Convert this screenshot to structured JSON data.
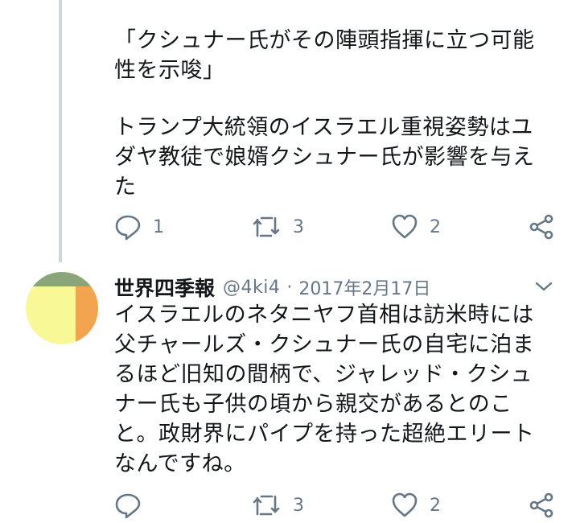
{
  "parent_tweet": {
    "text_1": "「クシュナー氏がその陣頭指揮に立つ可能性を示唆」",
    "text_2": "トランプ大統領のイスラエル重視姿勢はユダヤ教徒で娘婿クシュナー氏が影響を与えた",
    "actions": {
      "reply_count": "1",
      "retweet_count": "3",
      "like_count": "2"
    }
  },
  "reply_tweet": {
    "display_name": "世界四季報",
    "handle": "@4ki4",
    "separator": "·",
    "date": "2017年2月17日",
    "text": "イスラエルのネタニヤフ首相は訪米時には父チャールズ・クシュナー氏の自宅に泊まるほど旧知の間柄で、ジャレッド・クシュナー氏も子供の頃から親交があるとのこと。政財界にパイプを持った超絶エリートなんですね。",
    "actions": {
      "reply_count": "",
      "retweet_count": "3",
      "like_count": "2"
    }
  },
  "colors": {
    "text": "#14171a",
    "secondary": "#657786",
    "thread_line": "#ccd6dd",
    "avatar_green": "#8aa57a",
    "avatar_yellow": "#f9f897",
    "avatar_orange": "#f2a44f"
  },
  "icons": [
    "reply-icon",
    "retweet-icon",
    "like-icon",
    "share-icon",
    "chevron-down-icon"
  ]
}
